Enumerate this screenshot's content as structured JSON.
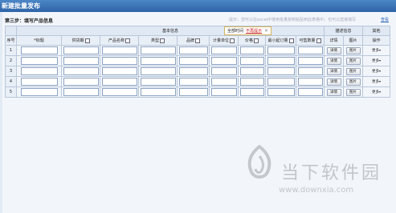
{
  "window": {
    "title": "新建批量发布"
  },
  "step_title": "第三步：填写产品信息",
  "hint": {
    "text": "提示：您可以在excel中使用批量复制粘贴到此表格中，也可以直接填写",
    "link": "查看"
  },
  "groups": {
    "basic": "基本信息",
    "desc": "描述信息",
    "other": "其他"
  },
  "columns": [
    "序号",
    "*标题",
    "供货期",
    "产品名称",
    "类型",
    "品牌",
    "计量单位",
    "价格",
    "最小起订量",
    "可售数量",
    "详情",
    "图片",
    "操作"
  ],
  "tooltip_tabs": {
    "first": "全部时间",
    "active": "不再提示",
    "close_glyph": "✕"
  },
  "rows": [
    {
      "no": "1",
      "detail": "详情",
      "image": "图片",
      "more": "更多"
    },
    {
      "no": "2",
      "detail": "详情",
      "image": "图片",
      "more": "更多"
    },
    {
      "no": "3",
      "detail": "详情",
      "image": "图片",
      "more": "更多"
    },
    {
      "no": "4",
      "detail": "详情",
      "image": "图片",
      "more": "更多"
    },
    {
      "no": "5",
      "detail": "详情",
      "image": "图片",
      "more": "更多"
    }
  ],
  "watermark": {
    "brand": "当下软件园",
    "url": "www.downxia.com"
  },
  "icons": {
    "more": "chevron-down-icon",
    "logo": "downxia-logo-icon"
  }
}
